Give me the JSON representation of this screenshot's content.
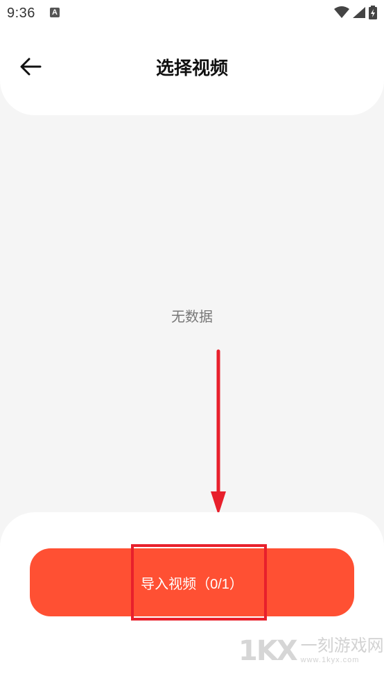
{
  "status_bar": {
    "time": "9:36",
    "notification_letter": "A"
  },
  "header": {
    "title": "选择视频",
    "back_icon": "arrow-left-icon"
  },
  "main": {
    "empty_text": "无数据"
  },
  "bottom": {
    "import_label": "导入视频（0/1）"
  },
  "watermark": {
    "logo": "1KX",
    "name": "一刻游戏网",
    "url": "www.1kyx.com"
  },
  "colors": {
    "accent": "#ff5033",
    "annotation": "#e8202c",
    "background": "#f5f5f5"
  }
}
